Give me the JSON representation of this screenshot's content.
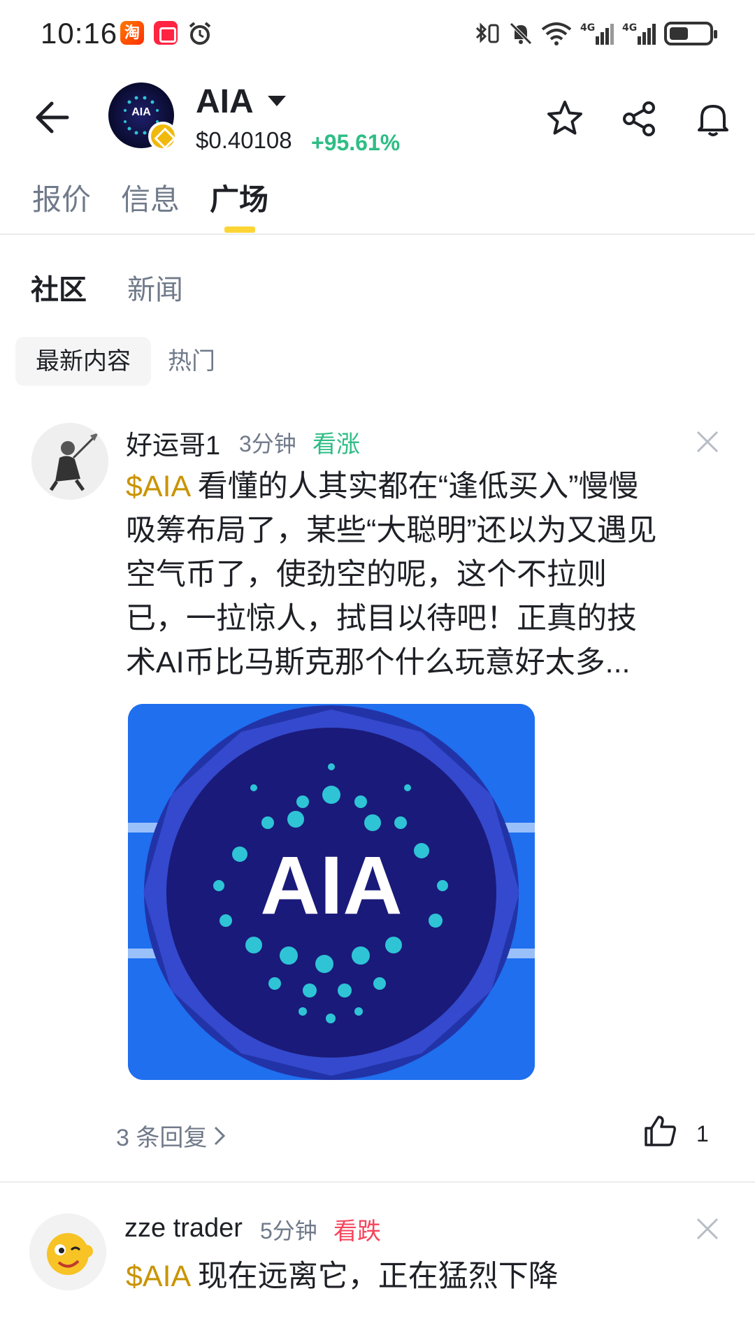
{
  "status_bar": {
    "time": "10:16",
    "taobao_label": "淘",
    "network_1": "4G",
    "network_2": "4G"
  },
  "header": {
    "coin_name": "AIA",
    "logo_text": "AIA",
    "price": "$0.40108",
    "change": "+95.61%",
    "change_color": "#2ebd85",
    "actions": [
      "star-icon",
      "share-icon",
      "bell-icon"
    ]
  },
  "main_tabs": [
    {
      "label": "报价"
    },
    {
      "label": "信息"
    },
    {
      "label": "广场"
    }
  ],
  "main_tabs_active": "广场",
  "sub_tabs": [
    {
      "label": "社区"
    },
    {
      "label": "新闻"
    }
  ],
  "filters": [
    {
      "label": "最新内容"
    },
    {
      "label": "热门"
    }
  ],
  "posts": [
    {
      "user": "好运哥1",
      "time": "3分钟",
      "sentiment": "看涨",
      "sentiment_color": "#2ebd85",
      "cashtag": "$AIA",
      "lines": [
        " 看懂的人其实都在“逢低买入”慢慢",
        "吸筹布局了，某些“大聪明”还以为又遇见",
        "空气币了，使劲空的呢，这个不拉则",
        "已，一拉惊人，拭目以待吧！正真的技",
        "术AI币比马斯克那个什么玩意好太多..."
      ],
      "image_text": "AIA",
      "replies": "3 条回复",
      "likes": "1"
    },
    {
      "user": "zze trader",
      "time": "5分钟",
      "sentiment": "看跌",
      "sentiment_color": "#f6465d",
      "cashtag": "$AIA",
      "text": " 现在远离它，正在猛烈下降"
    }
  ]
}
